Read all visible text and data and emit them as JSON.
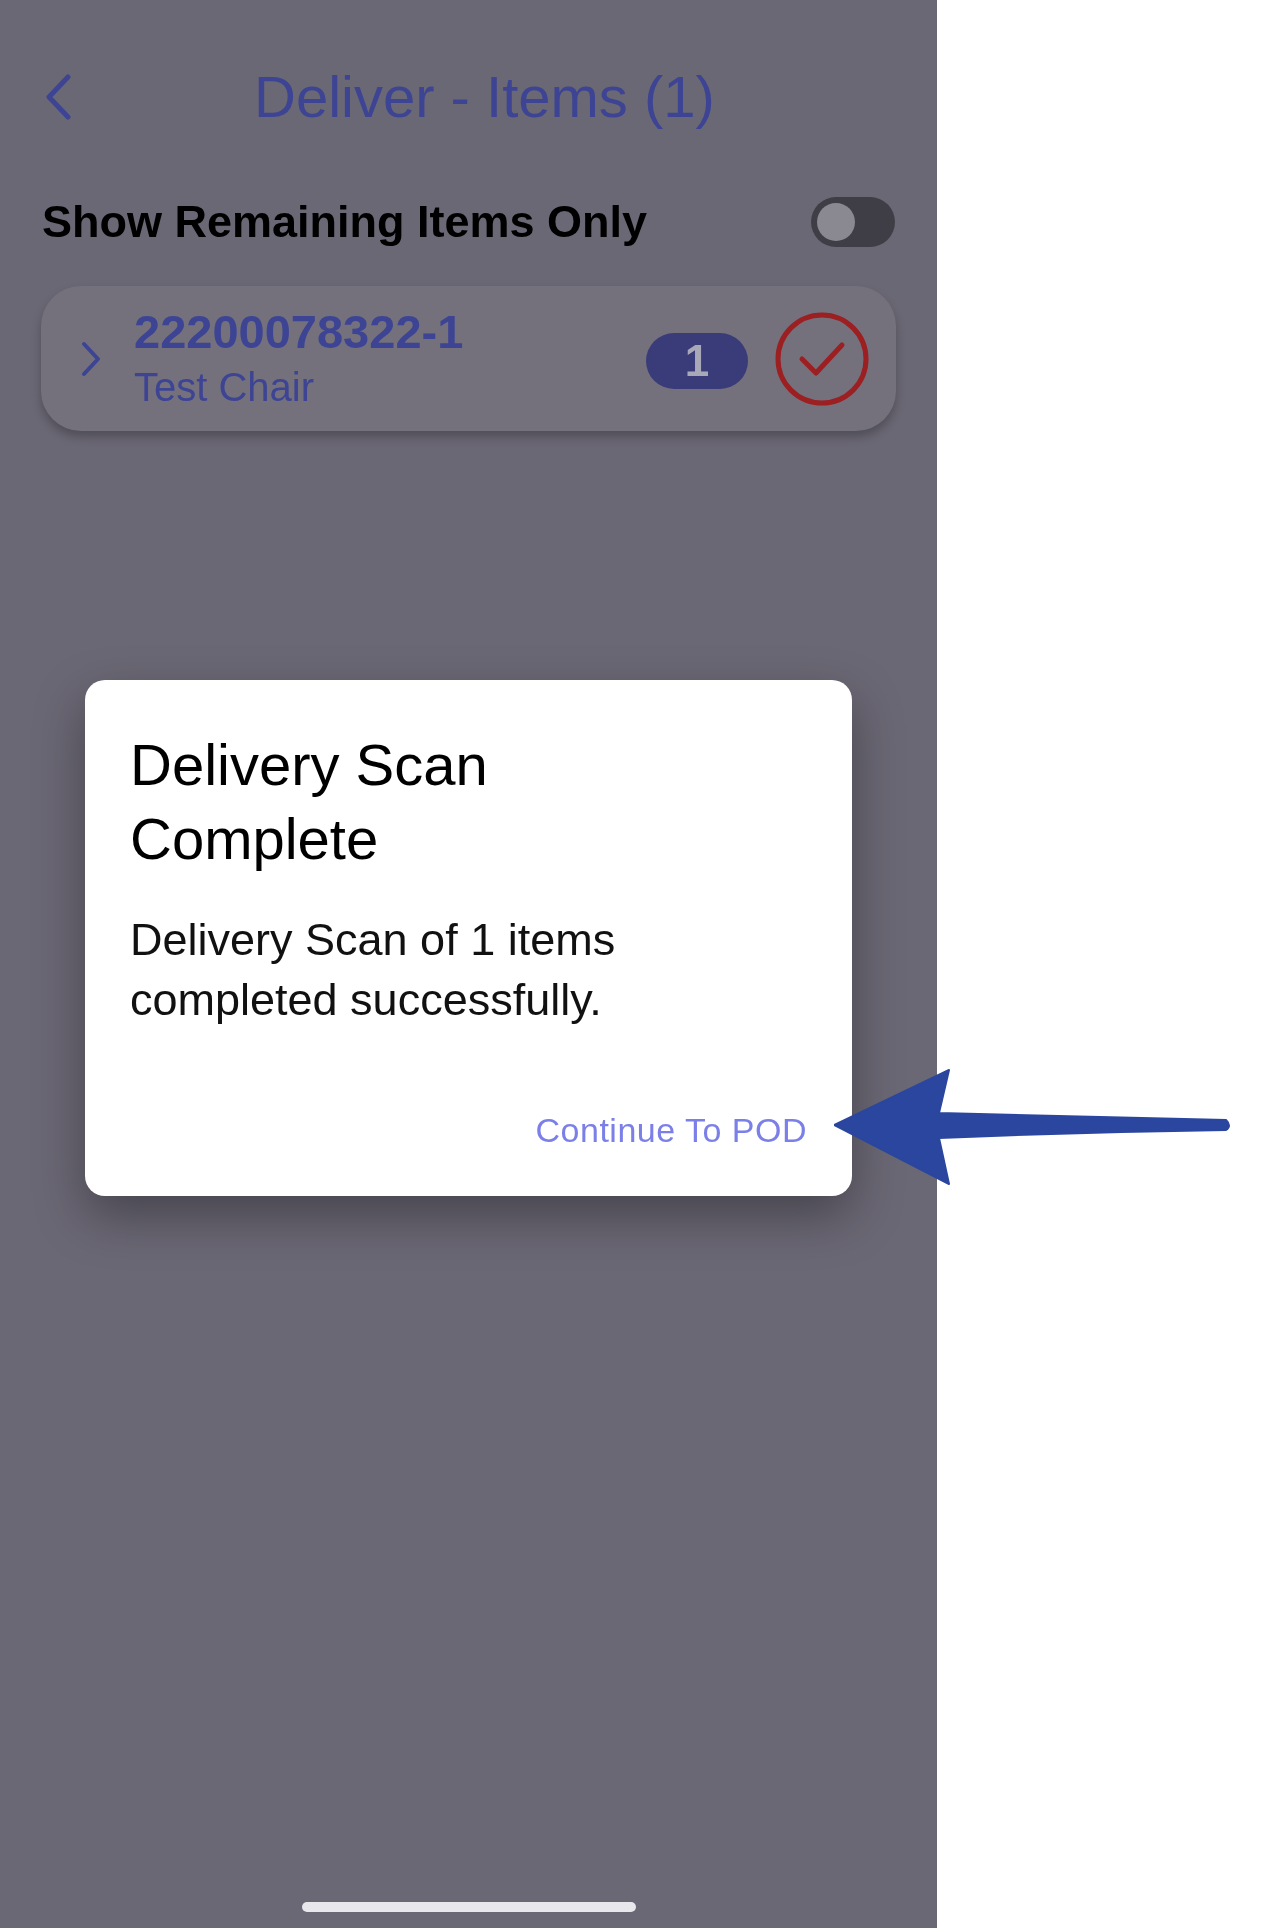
{
  "header": {
    "title": "Deliver - Items (1)"
  },
  "filter": {
    "label": "Show Remaining Items Only",
    "on": false
  },
  "items": [
    {
      "number": "22200078322-1",
      "name": "Test Chair",
      "quantity": "1",
      "checked": true
    }
  ],
  "dialog": {
    "title": "Delivery Scan Complete",
    "message": "Delivery Scan of 1 items completed successfully.",
    "action": "Continue To POD"
  }
}
